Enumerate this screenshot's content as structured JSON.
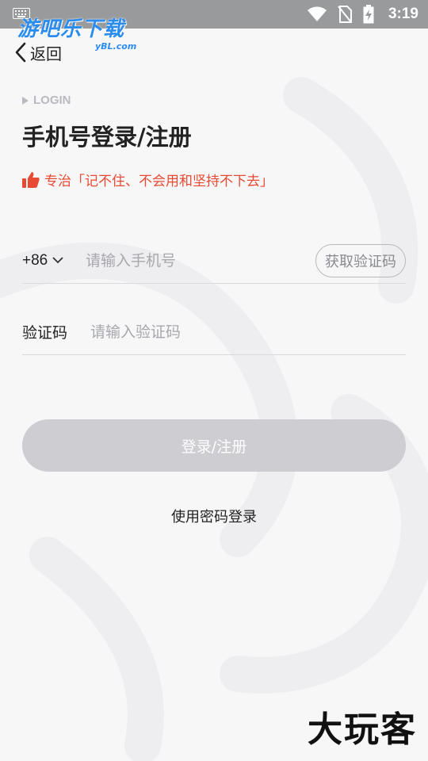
{
  "status_bar": {
    "time": "3:19",
    "icons": [
      "keyboard-icon",
      "wifi-icon",
      "no-sim-icon",
      "battery-charging-icon"
    ]
  },
  "watermark": {
    "title": "游吧乐下载",
    "subtitle": "yBL.com"
  },
  "header": {
    "back_label": "返回"
  },
  "login_tag": "LOGIN",
  "page_title": "手机号登录/注册",
  "slogan": {
    "text": "专治「记不住、不会用和坚持不下去」",
    "icon": "thumbs-up-icon",
    "color": "#e84a33"
  },
  "form": {
    "country_code": "+86",
    "phone_placeholder": "请输入手机号",
    "get_code_label": "获取验证码",
    "code_label": "验证码",
    "code_placeholder": "请输入验证码"
  },
  "submit_label": "登录/注册",
  "password_login_label": "使用密码登录",
  "brand": "大玩客",
  "colors": {
    "accent": "#e84a33",
    "button_disabled": "#cdcdd2",
    "status_bar": "#999a9c"
  }
}
